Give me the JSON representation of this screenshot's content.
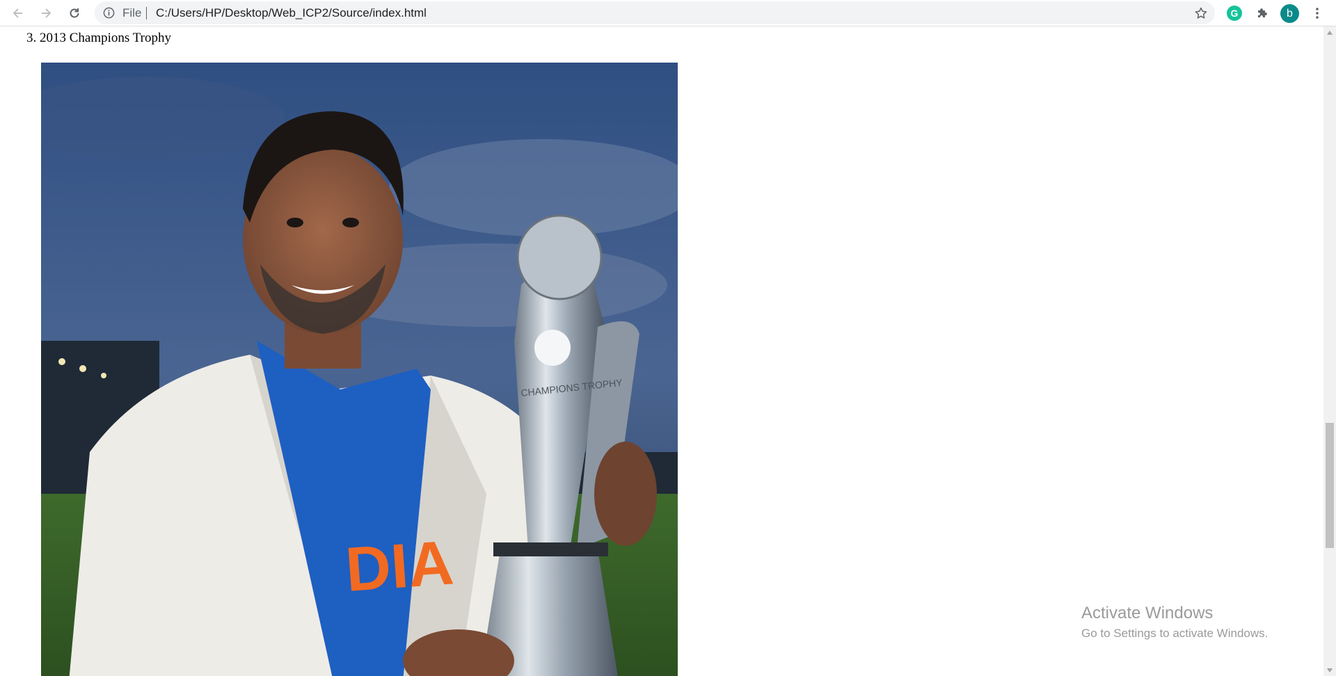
{
  "browser": {
    "omnibox": {
      "scheme_label": "File",
      "url": "C:/Users/HP/Desktop/Web_ICP2/Source/index.html"
    },
    "extensions": {
      "grammarly_letter": "G"
    },
    "profile": {
      "initial": "b"
    },
    "icons": [
      "back-icon",
      "forward-icon",
      "reload-icon",
      "info-icon",
      "star-icon",
      "puzzle-icon",
      "kebab-menu-icon"
    ]
  },
  "page": {
    "list_item_text": "3. 2013 Champions Trophy",
    "image_alt": "Player holding the 2013 Champions Trophy",
    "trophy_text": "CHAMPIONS TROPHY",
    "jersey_text": "DIA"
  },
  "watermark": {
    "title": "Activate Windows",
    "subtitle": "Go to Settings to activate Windows."
  },
  "colors": {
    "avatar": "#0b8a8a",
    "grammarly": "#15c39a",
    "jersey_blue": "#1e5fc2",
    "jersey_orange": "#f26a21"
  }
}
